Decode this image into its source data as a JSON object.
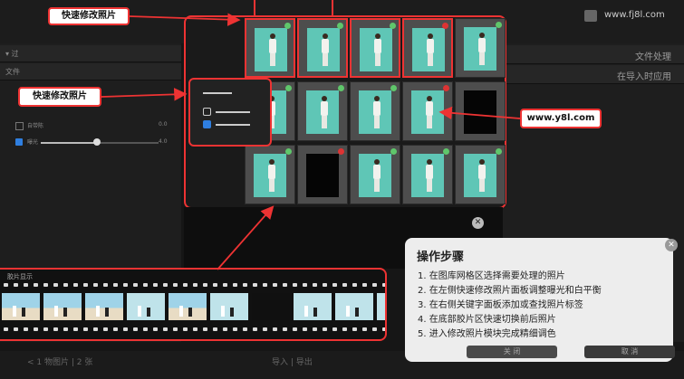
{
  "site": {
    "logo_text": "www.fj8l.com"
  },
  "left_panel": {
    "rows": [
      "▾ 过",
      "文件"
    ],
    "options": [
      "自带陈",
      "曝光"
    ],
    "values": [
      "0.0",
      "4.0"
    ]
  },
  "right_panel": {
    "header1": "文件处理",
    "header2": "在导入时应用"
  },
  "callouts": {
    "top_label": "快速修改照片",
    "left_label": "快速修改照片",
    "url_label": "www.y8l.com"
  },
  "grid": {
    "rows": [
      [
        {
          "badge": "ok",
          "sel": true,
          "dark": false
        },
        {
          "badge": "ok",
          "sel": true,
          "dark": false
        },
        {
          "badge": "ok",
          "sel": true,
          "dark": false
        },
        {
          "badge": "rej",
          "sel": true,
          "dark": false
        },
        {
          "badge": "ok",
          "sel": false,
          "dark": false
        }
      ],
      [
        {
          "badge": "ok",
          "sel": false,
          "dark": false
        },
        {
          "badge": "ok",
          "sel": false,
          "dark": false
        },
        {
          "badge": "ok",
          "sel": false,
          "dark": false
        },
        {
          "badge": "rej",
          "sel": false,
          "dark": false
        },
        {
          "badge": "",
          "sel": false,
          "dark": true
        }
      ],
      [
        {
          "badge": "ok",
          "sel": false,
          "dark": false
        },
        {
          "badge": "rej",
          "sel": false,
          "dark": true
        },
        {
          "badge": "ok",
          "sel": false,
          "dark": false
        },
        {
          "badge": "ok",
          "sel": false,
          "dark": false
        },
        {
          "badge": "ok",
          "sel": false,
          "dark": false
        }
      ]
    ]
  },
  "filmstrip": {
    "header": "胶片显示",
    "thumbs": [
      "sea",
      "sea",
      "sea",
      "light",
      "sea",
      "light",
      "dark",
      "light",
      "light",
      "light"
    ]
  },
  "steps": {
    "title": "操作步骤",
    "items": [
      "1. 在图库网格区选择需要处理的照片",
      "2. 在左侧快速修改照片面板调整曝光和白平衡",
      "3. 在右侧关键字面板添加或查找照片标签",
      "4. 在底部胶片区快速切换前后照片",
      "5. 进入修改照片模块完成精细调色"
    ],
    "ok_label": "关 闭",
    "cancel_label": "取 消"
  },
  "bottom": {
    "left_text": "< 1 物图片 | 2 张",
    "mid_text": "导入 | 导出"
  },
  "colors": {
    "accent": "#e33",
    "teal": "#5fc6b6",
    "panel": "#ededed"
  }
}
